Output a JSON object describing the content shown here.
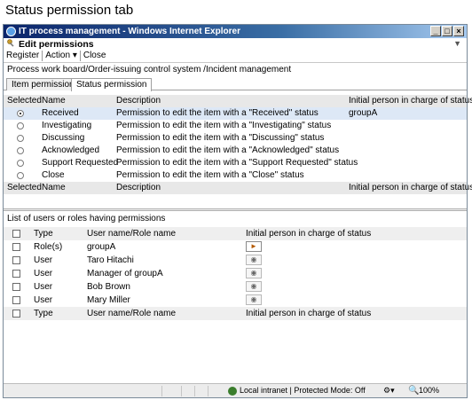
{
  "caption": "Status permission tab",
  "window": {
    "title": "IT process management - Windows Internet Explorer",
    "buttons": [
      "_",
      "□",
      "×"
    ]
  },
  "app": {
    "title": "Edit permissions",
    "menu": [
      "Register",
      "Action ▾",
      "Close"
    ]
  },
  "breadcrumb": "Process work board/Order-issuing control system /Incident management",
  "tabs": [
    {
      "label": "Item permission",
      "active": false
    },
    {
      "label": "Status permission",
      "active": true
    }
  ],
  "status_table": {
    "headers": {
      "selected": "Selected",
      "name": "Name",
      "description": "Description",
      "initial": "Initial person in charge of status"
    },
    "rows": [
      {
        "name": "Received",
        "description": "Permission to edit the item with a \"Received\" status",
        "initial": "groupA",
        "selected": true
      },
      {
        "name": "Investigating",
        "description": "Permission to edit the item with a \"Investigating\" status",
        "initial": "",
        "selected": false
      },
      {
        "name": "Discussing",
        "description": "Permission to edit the item with a \"Discussing\" status",
        "initial": "",
        "selected": false
      },
      {
        "name": "Acknowledged",
        "description": "Permission to edit the item with a \"Acknowledged\" status",
        "initial": "",
        "selected": false
      },
      {
        "name": "Support Requested",
        "description": "Permission to edit the item with a \"Support Requested\" status",
        "initial": "",
        "selected": false
      },
      {
        "name": "Close",
        "description": "Permission to edit the item with a \"Close\" status",
        "initial": "",
        "selected": false
      }
    ]
  },
  "permissions": {
    "label": "List of users or roles having permissions",
    "headers": {
      "type": "Type",
      "name": "User name/Role name",
      "initial": "Initial person in charge of status"
    },
    "rows": [
      {
        "type": "Role(s)",
        "name": "groupA",
        "initial_active": true
      },
      {
        "type": "User",
        "name": "Taro Hitachi",
        "initial_active": false
      },
      {
        "type": "User",
        "name": "Manager of groupA",
        "initial_active": false
      },
      {
        "type": "User",
        "name": "Bob Brown",
        "initial_active": false
      },
      {
        "type": "User",
        "name": "Mary Miller",
        "initial_active": false
      }
    ]
  },
  "statusbar": {
    "zone": "Local intranet | Protected Mode: Off",
    "zoom": "100%"
  },
  "colors": {
    "titlebar_start": "#0a246a",
    "selected_row": "#dde8f6"
  }
}
